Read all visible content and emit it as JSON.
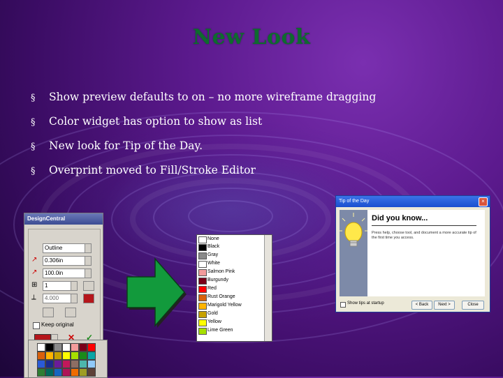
{
  "slide": {
    "title": "New Look",
    "bullet_symbol": "§",
    "bullets": [
      "Show preview defaults to on – no more wireframe dragging",
      "Color widget has option to show as list",
      "New look for Tip of the Day.",
      "Overprint moved to Fill/Stroke Editor"
    ]
  },
  "design_central": {
    "title": "DesignCentral",
    "outline_label": "Outline",
    "width_value": "0.306in",
    "size_value": "100.0in",
    "count_value": "1",
    "other_value": "4.000",
    "keep_original": "Keep original"
  },
  "color_list": {
    "header": "None",
    "items": [
      {
        "name": "Black",
        "color": "#000000"
      },
      {
        "name": "Gray",
        "color": "#8a8a8a"
      },
      {
        "name": "White",
        "color": "#ffffff"
      },
      {
        "name": "Salmon Pink",
        "color": "#f29b9b"
      },
      {
        "name": "Burgundy",
        "color": "#7a0019"
      },
      {
        "name": "Red",
        "color": "#ff0000"
      },
      {
        "name": "Rust Orange",
        "color": "#d8600c"
      },
      {
        "name": "Marigold Yellow",
        "color": "#ffb400"
      },
      {
        "name": "Gold",
        "color": "#c7a100"
      },
      {
        "name": "Yellow",
        "color": "#ffff00"
      },
      {
        "name": "Lime Green",
        "color": "#a6e000"
      }
    ]
  },
  "tip_dialog": {
    "title": "Tip of the Day",
    "close_glyph": "×",
    "heading": "Did you know...",
    "body": "Press help, choose tool, and document a more accurate tip of the first time you access.",
    "checkbox_label": "Show tips at startup",
    "buttons": [
      "< Back",
      "Next >",
      "Close"
    ]
  },
  "colors": {
    "title_green": "#0e6b2e",
    "arrow_green": "#129a3c"
  }
}
